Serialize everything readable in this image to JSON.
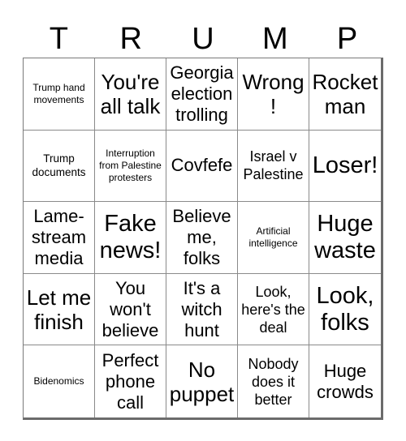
{
  "card": {
    "title_letters": [
      "T",
      "R",
      "U",
      "M",
      "P"
    ],
    "columns": 5,
    "rows": 5,
    "colors": {
      "background": "#ffffff",
      "text": "#000000",
      "grid_line": "#8a8a8a",
      "outer_border": "#6b6b6b"
    },
    "cells": [
      {
        "text": "Trump hand movements",
        "size": "xs"
      },
      {
        "text": "You're all talk",
        "size": "xl"
      },
      {
        "text": "Georgia election trolling",
        "size": "l"
      },
      {
        "text": "Wrong!",
        "size": "xl"
      },
      {
        "text": "Rocket man",
        "size": "xl"
      },
      {
        "text": "Trump documents",
        "size": "s"
      },
      {
        "text": "Interruption from Palestine protesters",
        "size": "xs"
      },
      {
        "text": "Covfefe",
        "size": "l"
      },
      {
        "text": "Israel v Palestine",
        "size": "m"
      },
      {
        "text": "Loser!",
        "size": "xxl"
      },
      {
        "text": "Lame-stream media",
        "size": "l"
      },
      {
        "text": "Fake news!",
        "size": "xxl"
      },
      {
        "text": "Believe me, folks",
        "size": "l"
      },
      {
        "text": "Artificial intelligence",
        "size": "xs"
      },
      {
        "text": "Huge waste",
        "size": "xxl"
      },
      {
        "text": "Let me finish",
        "size": "xl"
      },
      {
        "text": "You won't believe",
        "size": "l"
      },
      {
        "text": "It's a witch hunt",
        "size": "l"
      },
      {
        "text": "Look, here's the deal",
        "size": "m"
      },
      {
        "text": "Look, folks",
        "size": "xxl"
      },
      {
        "text": "Bidenomics",
        "size": "xs"
      },
      {
        "text": "Perfect phone call",
        "size": "l"
      },
      {
        "text": "No puppet",
        "size": "xl"
      },
      {
        "text": "Nobody does it better",
        "size": "m"
      },
      {
        "text": "Huge crowds",
        "size": "l"
      }
    ]
  }
}
